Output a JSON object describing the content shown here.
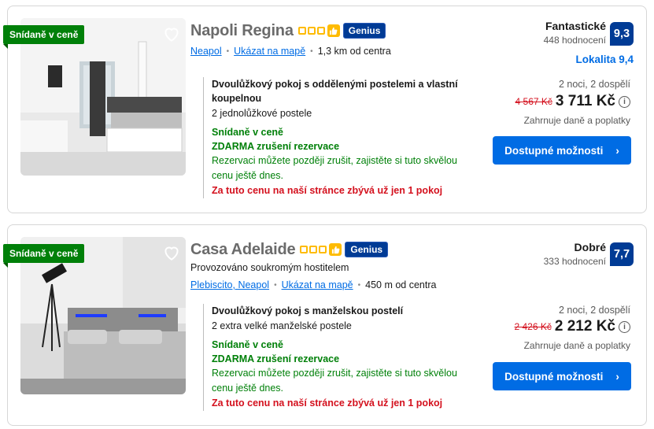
{
  "results": [
    {
      "badge": "Snídaně v ceně",
      "name": "Napoli Regina",
      "genius": "Genius",
      "subtitle": "",
      "location": "Neapol",
      "map_link": "Ukázat na mapě",
      "distance": "1,3 km od centra",
      "room_title": "Dvoulůžkový pokoj s oddělenými postelemi a vlastní koupelnou",
      "beds": "2 jednolůžkové postele",
      "breakfast": "Snídaně v ceně",
      "free_cancel": "ZDARMA zrušení rezervace",
      "cancel_note": "Rezervaci můžete později zrušit, zajistěte si tuto skvělou cenu ještě dnes.",
      "scarcity": "Za tuto cenu na naší stránce zbývá už jen 1 pokoj",
      "rating_word": "Fantastické",
      "reviews": "448 hodnocení",
      "score": "9,3",
      "location_score": "Lokalita 9,4",
      "nights": "2 noci, 2 dospělí",
      "old_price": "4 567 Kč",
      "price": "3 711 Kč",
      "taxes": "Zahrnuje daně a poplatky",
      "cta": "Dostupné možnosti"
    },
    {
      "badge": "Snídaně v ceně",
      "name": "Casa Adelaide",
      "genius": "Genius",
      "subtitle": "Provozováno soukromým hostitelem",
      "location": "Plebiscito, Neapol",
      "map_link": "Ukázat na mapě",
      "distance": "450 m od centra",
      "room_title": "Dvoulůžkový pokoj s manželskou postelí",
      "beds": "2 extra velké manželské postele",
      "breakfast": "Snídaně v ceně",
      "free_cancel": "ZDARMA zrušení rezervace",
      "cancel_note": "Rezervaci můžete později zrušit, zajistěte si tuto skvělou cenu ještě dnes.",
      "scarcity": "Za tuto cenu na naší stránce zbývá už jen 1 pokoj",
      "rating_word": "Dobré",
      "reviews": "333 hodnocení",
      "score": "7,7",
      "location_score": "",
      "nights": "2 noci, 2 dospělí",
      "old_price": "2 426 Kč",
      "price": "2 212 Kč",
      "taxes": "Zahrnuje daně a poplatky",
      "cta": "Dostupné možnosti"
    }
  ],
  "info_glyph": "i",
  "cta_chevron": "›",
  "colors": {
    "brand_blue": "#003b95",
    "link_blue": "#006ce4",
    "green": "#008009",
    "red": "#d4111e",
    "star_yellow": "#febb02"
  }
}
